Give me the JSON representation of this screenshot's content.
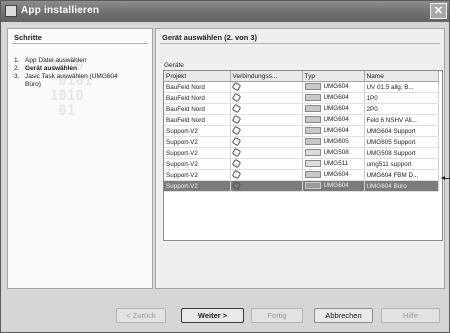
{
  "window": {
    "title": "App installieren",
    "close_glyph": "✕",
    "app_icon": "installer-icon"
  },
  "steps": {
    "header": "Schritte",
    "watermark": "1010\n 0101\n1010\n 01",
    "items": [
      {
        "num": "1.",
        "label": "App Datei auswählen",
        "active": false
      },
      {
        "num": "2.",
        "label": "Gerät auswählen",
        "active": true
      },
      {
        "num": "3.",
        "label": "Jasic Task auswählen (UMG604 Büro)",
        "active": false
      }
    ]
  },
  "main": {
    "header": "Gerät auswählen (2. von 3)",
    "group_label": "Geräte",
    "columns": [
      "Projekt",
      "Verbindungss...",
      "Typ",
      "Name"
    ],
    "rows": [
      {
        "projekt": "BauFeld Nord",
        "typ": "UMG604",
        "name": "UV 01.5 allg. B...",
        "thumb": "dark",
        "selected": false
      },
      {
        "projekt": "BauFeld Nord",
        "typ": "UMG604",
        "name": "1P0",
        "thumb": "dark",
        "selected": false
      },
      {
        "projekt": "BauFeld Nord",
        "typ": "UMG604",
        "name": "2P0",
        "thumb": "dark",
        "selected": false
      },
      {
        "projekt": "BauFeld Nord",
        "typ": "UMG604",
        "name": "Feld 6 NSHV All...",
        "thumb": "dark",
        "selected": false
      },
      {
        "projekt": "Support-V2",
        "typ": "UMG604",
        "name": "UMG604 Support",
        "thumb": "dark",
        "selected": false
      },
      {
        "projekt": "Support-V2",
        "typ": "UMG605",
        "name": "UMG605 Support",
        "thumb": "dark",
        "selected": false
      },
      {
        "projekt": "Support-V2",
        "typ": "UMG508",
        "name": "UMG508 Support",
        "thumb": "light",
        "selected": false
      },
      {
        "projekt": "Support-V2",
        "typ": "UMG511",
        "name": "umg511 support",
        "thumb": "light",
        "selected": false
      },
      {
        "projekt": "Support-V2",
        "typ": "UMG604",
        "name": "UMG604 FBM D...",
        "thumb": "dark",
        "selected": false
      },
      {
        "projekt": "Support-V2",
        "typ": "UMG604",
        "name": "UMG604 Büro",
        "thumb": "dark",
        "selected": true
      }
    ]
  },
  "buttons": {
    "back": "< Zurück",
    "next": "Weiter >",
    "finish": "Fertig",
    "cancel": "Abbrechen",
    "help": "Hilfe"
  }
}
